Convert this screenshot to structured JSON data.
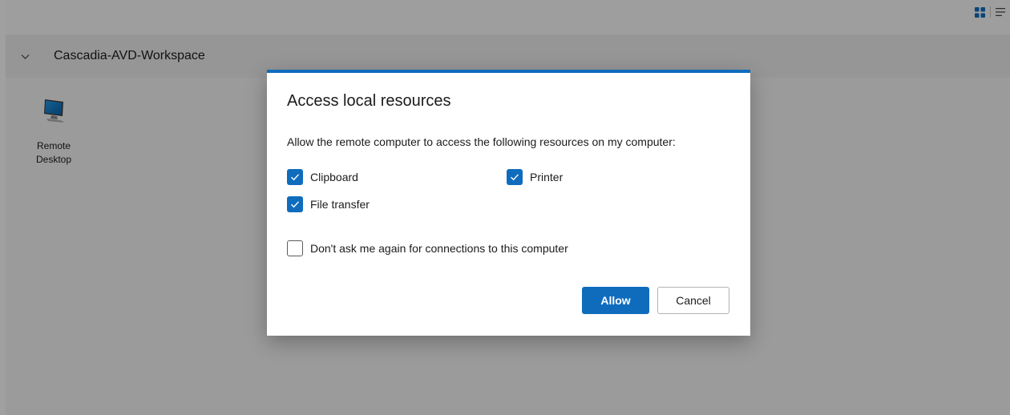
{
  "workspace": {
    "title": "Cascadia-AVD-Workspace",
    "collapse_icon": "chevron-down-icon"
  },
  "view_toggle": {
    "grid_icon": "grid-view-icon",
    "list_icon": "list-view-icon"
  },
  "tiles": [
    {
      "label_line1": "Remote",
      "label_line2": "Desktop",
      "icon": "monitor-icon"
    }
  ],
  "dialog": {
    "title": "Access local resources",
    "description": "Allow the remote computer to access the following resources on my computer:",
    "options": {
      "clipboard": {
        "label": "Clipboard",
        "checked": true
      },
      "printer": {
        "label": "Printer",
        "checked": true
      },
      "file_transfer": {
        "label": "File transfer",
        "checked": true
      }
    },
    "dont_ask": {
      "label": "Don't ask me again for connections to this computer",
      "checked": false
    },
    "allow_label": "Allow",
    "cancel_label": "Cancel"
  },
  "colors": {
    "accent": "#0f6cbd"
  }
}
